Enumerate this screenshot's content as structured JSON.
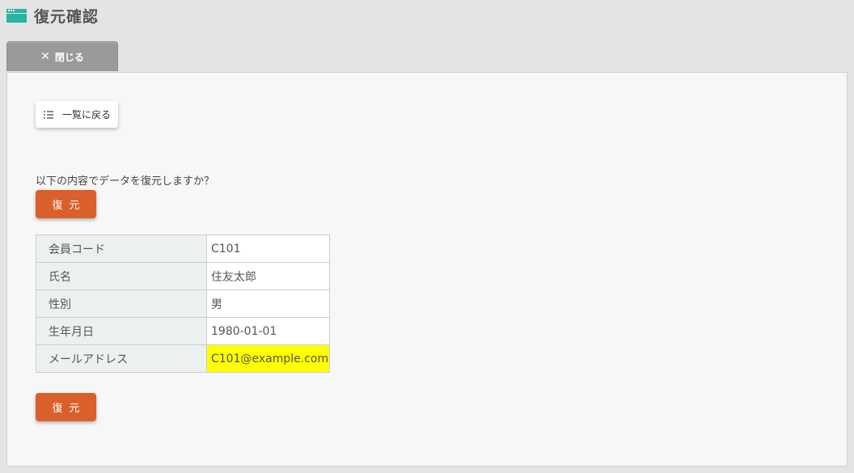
{
  "header": {
    "title": "復元確認",
    "icon": "window-icon"
  },
  "tabs": {
    "close_label": "閉じる",
    "close_icon": "close-icon"
  },
  "main": {
    "back_label": "一覧に戻る",
    "back_icon": "list-icon",
    "message": "以下の内容でデータを復元しますか？",
    "restore_label": "復元",
    "fields": [
      {
        "label": "会員コード",
        "value": "C101"
      },
      {
        "label": "氏名",
        "value": "住友太郎"
      },
      {
        "label": "性別",
        "value": "男"
      },
      {
        "label": "生年月日",
        "value": "1980-01-01"
      },
      {
        "label": "メールアドレス",
        "value": "C101@example.com",
        "highlight": true
      }
    ]
  },
  "colors": {
    "accent": "#2bb3a3",
    "primary_button": "#d9602a",
    "highlight": "#ffff00",
    "key_cell_bg": "#ebf1f1"
  }
}
